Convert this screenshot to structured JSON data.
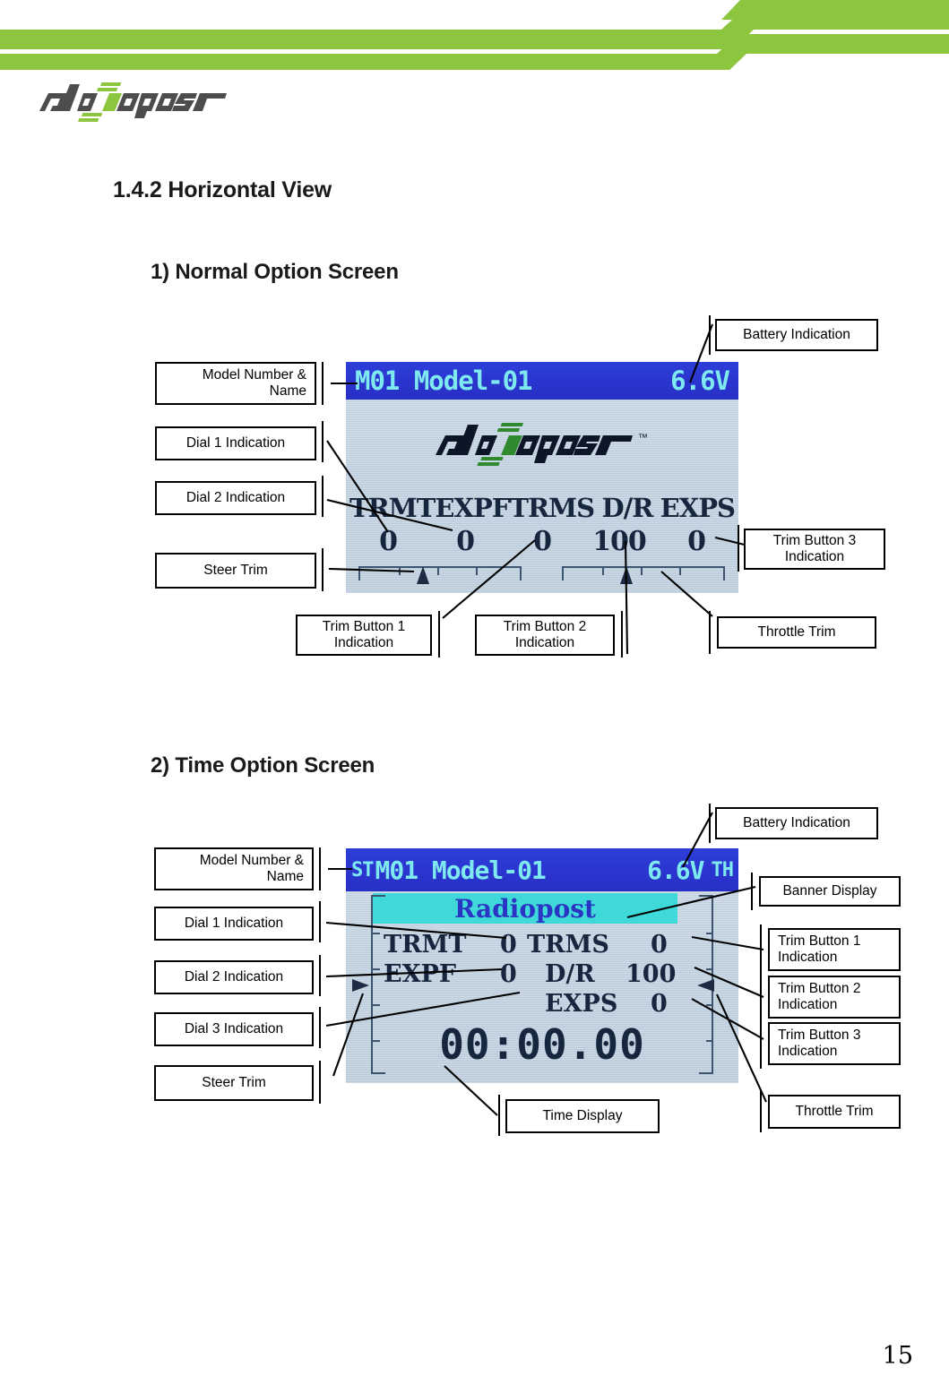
{
  "brand": {
    "logo_text": "radiopost",
    "accent_color": "#8cc63e"
  },
  "page": {
    "number": "15"
  },
  "headings": {
    "section": "1.4.2 Horizontal View",
    "sub1": "1) Normal Option Screen",
    "sub2": "2) Time Option Screen"
  },
  "screen1": {
    "title_left": "M01 Model-01",
    "title_right": "6.6V",
    "logo_text": "radiopost",
    "logo_tm": "TM",
    "param_labels": [
      "TRMT",
      "EXPF",
      "TRMS",
      "D/R",
      "EXPS"
    ],
    "param_values": [
      "0",
      "0",
      "0",
      "100",
      "0"
    ],
    "callouts": {
      "model": "Model Number &\nName",
      "dial1": "Dial 1 Indication",
      "dial2": "Dial 2 Indication",
      "steer_trim": "Steer Trim",
      "battery": "Battery Indication",
      "trim3": "Trim Button 3\nIndication",
      "trim1": "Trim Button 1\nIndication",
      "trim2": "Trim Button 2\nIndication",
      "throttle_trim": "Throttle Trim"
    }
  },
  "screen2": {
    "title_st": "ST",
    "title_left": "M01 Model-01",
    "title_right": "6.6V",
    "title_th": "TH",
    "banner": "Radiopost",
    "rows": [
      {
        "l1": "TRMT",
        "v1": "0",
        "l2": "TRMS",
        "v2": "0"
      },
      {
        "l1": "EXPF",
        "v1": "0",
        "l2": "D/R",
        "v2": "100"
      },
      {
        "l1": "",
        "v1": "",
        "l2": "EXPS",
        "v2": "0"
      }
    ],
    "time": "00:00.00",
    "callouts": {
      "model": "Model Number &\nName",
      "dial1": "Dial 1 Indication",
      "dial2": "Dial 2 Indication",
      "dial3": "Dial 3 Indication",
      "steer_trim": "Steer Trim",
      "battery": "Battery Indication",
      "banner_display": "Banner Display",
      "trim1": "Trim Button 1\nIndication",
      "trim2": "Trim Button 2\nIndication",
      "trim3": "Trim Button 3\nIndication",
      "throttle_trim": "Throttle Trim",
      "time_display": "Time Display"
    }
  }
}
